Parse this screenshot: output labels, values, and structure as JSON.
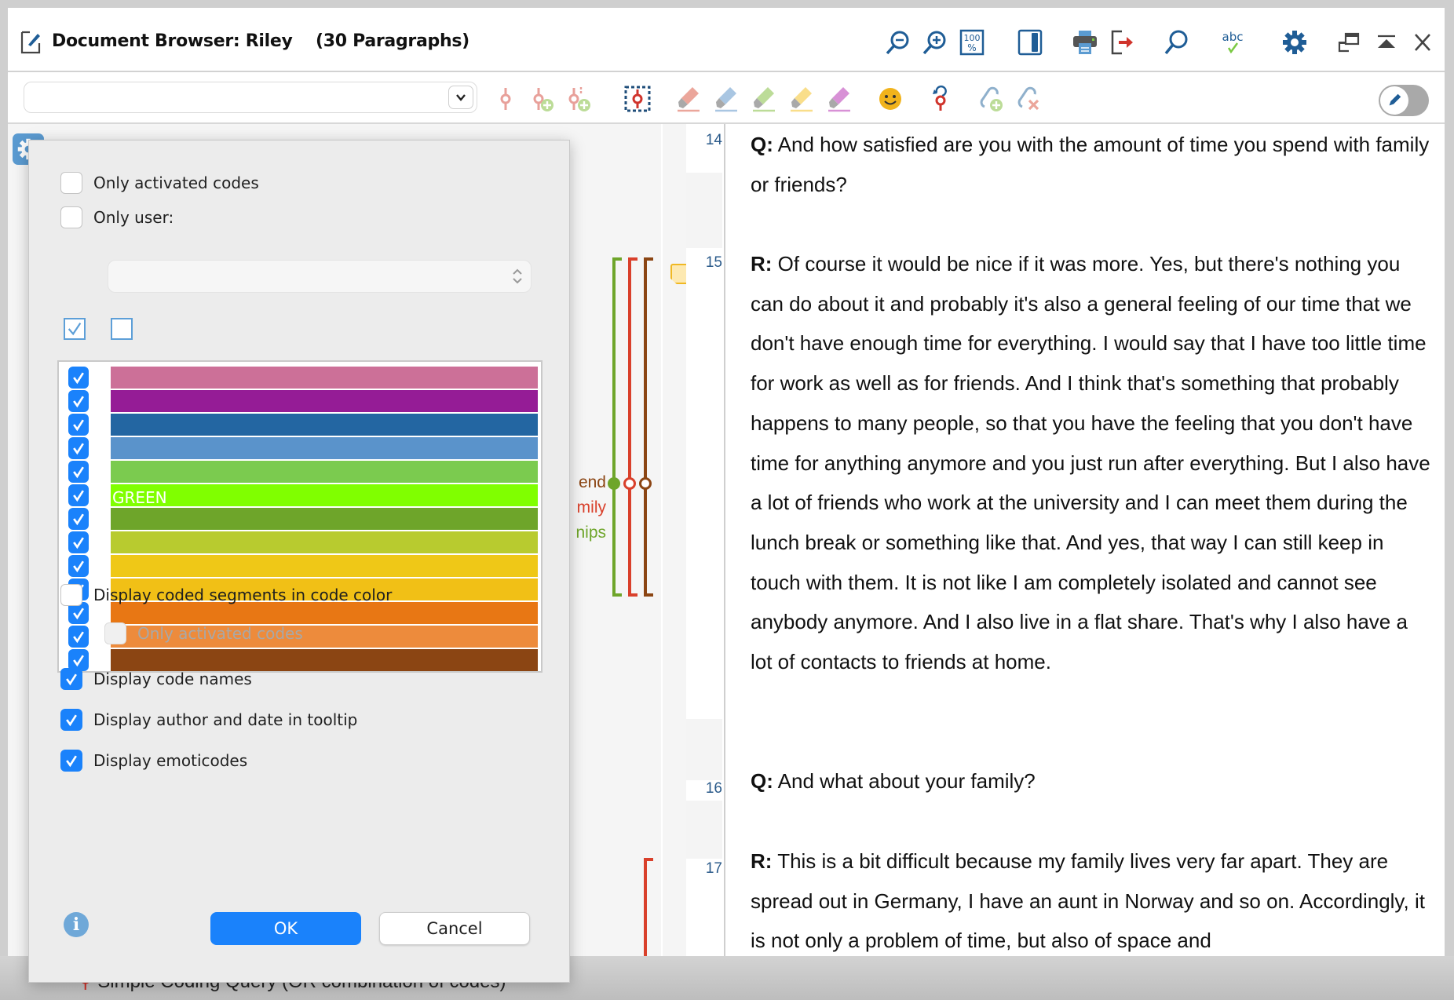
{
  "window": {
    "title": "Document Browser: Riley",
    "paragraph_count": "(30 Paragraphs)"
  },
  "titlebar_icons": [
    {
      "name": "zoom-out-icon"
    },
    {
      "name": "zoom-in-icon"
    },
    {
      "name": "zoom-100-icon"
    },
    {
      "name": "toggle-panel-icon"
    },
    {
      "name": "print-icon"
    },
    {
      "name": "export-icon"
    },
    {
      "name": "search-icon"
    },
    {
      "name": "spellcheck-icon"
    },
    {
      "name": "settings-gear-icon"
    },
    {
      "name": "undock-window-icon"
    },
    {
      "name": "move-to-top-icon"
    },
    {
      "name": "close-icon"
    }
  ],
  "toolbar": {
    "code_selector_value": "",
    "icons": [
      {
        "name": "code-icon",
        "color": "#e8a09a"
      },
      {
        "name": "new-code-icon",
        "color": "#e8a09a"
      },
      {
        "name": "new-code-plus-icon",
        "color": "#e8a09a"
      },
      {
        "name": "code-in-vivo-icon",
        "color": "#d0342c"
      },
      {
        "name": "highlight-red-icon",
        "color": "#eba69b"
      },
      {
        "name": "highlight-blue-icon",
        "color": "#a9c6e2"
      },
      {
        "name": "highlight-green-icon",
        "color": "#bcdc98"
      },
      {
        "name": "highlight-yellow-icon",
        "color": "#f9de8a"
      },
      {
        "name": "highlight-magenta-icon",
        "color": "#d891d6"
      },
      {
        "name": "emoticode-icon",
        "color": "#f1b31c"
      },
      {
        "name": "undo-coding-icon",
        "color": "#d0342c"
      },
      {
        "name": "add-link-icon",
        "color": "#8fb0cc"
      },
      {
        "name": "remove-link-icon",
        "color": "#8fb0cc"
      }
    ],
    "edit_mode_toggle": "off"
  },
  "dialog": {
    "only_activated_codes": {
      "label": "Only activated codes",
      "checked": false
    },
    "only_user": {
      "label": "Only user:",
      "checked": false
    },
    "user_select_value": "",
    "color_filters": [
      {
        "color": "#cc7098",
        "checked": true,
        "label": ""
      },
      {
        "color": "#951c96",
        "checked": true,
        "label": ""
      },
      {
        "color": "#2366a2",
        "checked": true,
        "label": ""
      },
      {
        "color": "#5a93cb",
        "checked": true,
        "label": ""
      },
      {
        "color": "#7bcb4f",
        "checked": true,
        "label": ""
      },
      {
        "color": "#80ff00",
        "checked": true,
        "label": "GREEN"
      },
      {
        "color": "#6ea52a",
        "checked": true,
        "label": ""
      },
      {
        "color": "#b8cb2f",
        "checked": true,
        "label": ""
      },
      {
        "color": "#efc817",
        "checked": true,
        "label": ""
      },
      {
        "color": "#f1c016",
        "checked": true,
        "label": ""
      },
      {
        "color": "#e87714",
        "checked": true,
        "label": ""
      },
      {
        "color": "#ed8b3c",
        "checked": true,
        "label": ""
      },
      {
        "color": "#8b4513",
        "checked": true,
        "label": ""
      }
    ],
    "display_in_code_color": {
      "label": "Display coded segments in code color",
      "checked": false
    },
    "only_activated_codes_sub": {
      "label": "Only activated codes",
      "checked": false,
      "disabled": true
    },
    "display_code_names": {
      "label": "Display code names",
      "checked": true
    },
    "display_author_date": {
      "label": "Display author and date in tooltip",
      "checked": true
    },
    "display_emoticodes": {
      "label": "Display emoticodes",
      "checked": true
    },
    "ok_label": "OK",
    "cancel_label": "Cancel"
  },
  "code_stripes": {
    "colors": {
      "green": "#6ea52a",
      "red": "#d9402b",
      "brown": "#8b4513"
    },
    "names": [
      {
        "text": "end",
        "color": "#8b4513"
      },
      {
        "text": "mily",
        "color": "#d9402b"
      },
      {
        "text": "nips",
        "color": "#6ea52a"
      }
    ]
  },
  "document": {
    "paragraphs": [
      {
        "number": "14",
        "speaker": "Q:",
        "text": " And how satisfied are you with the amount of time you spend with family or friends?"
      },
      {
        "number": "15",
        "speaker": "R:",
        "text": " Of course it would be nice if it was more. Yes, but there's nothing you can do about it and probably it's also a general feeling of our time that we don't have enough time for everything. I would say that I have too little time for work as well as for friends. And I think that's something that probably happens to many people, so that you have the feeling that you don't have time for anything anymore and you just run after everything. But I also have a lot of friends who work at the university and I can meet them during the lunch break or something like that. And yes, that way I can still keep in touch with them. It is not like I am completely isolated and cannot see anybody anymore. And I also live in a flat share. That's why I also have a lot of contacts to friends at home."
      },
      {
        "number": "16",
        "speaker": "Q:",
        "text": " And what about your family?"
      },
      {
        "number": "17",
        "speaker": "R:",
        "text": " This is a bit difficult because my family lives very far apart. They are spread out in Germany, I have an aunt in Norway and so on. Accordingly, it is not only a problem of time, but also of space and"
      }
    ],
    "memo_present_on": "15"
  },
  "background_window": {
    "query_text": "Simple Coding Query (OR combination of codes)"
  }
}
